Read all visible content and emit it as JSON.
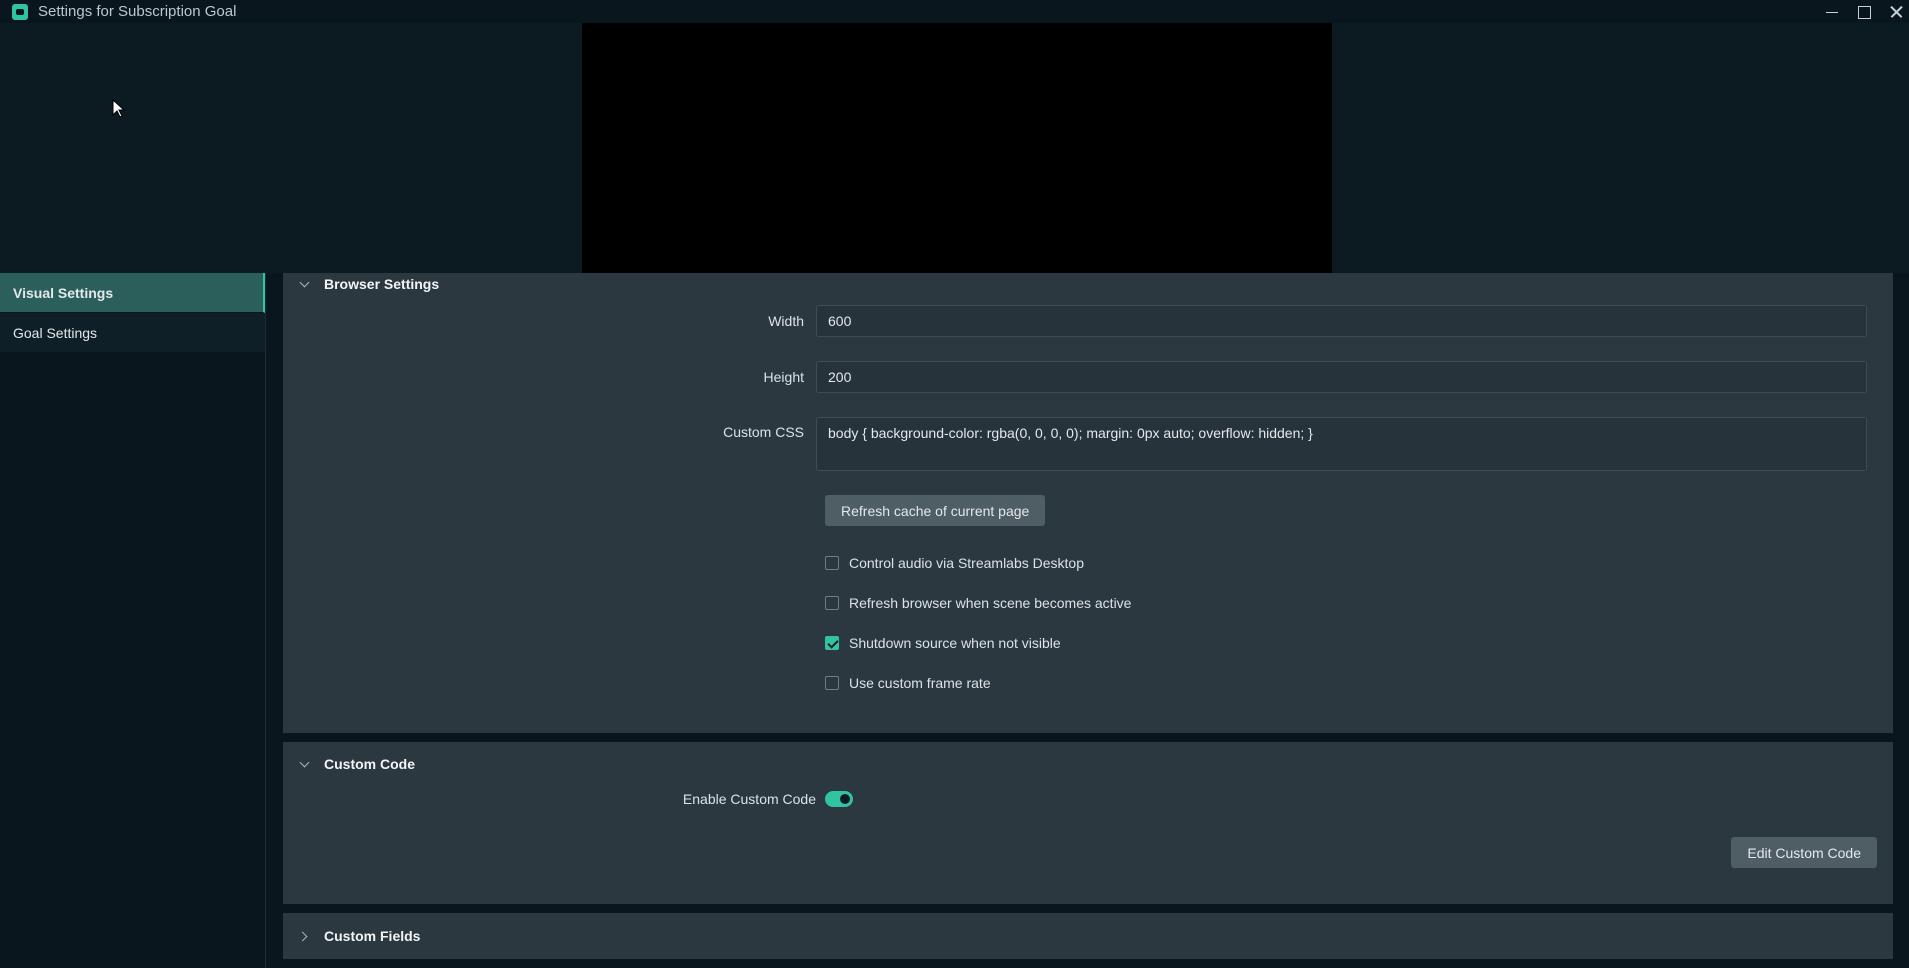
{
  "window": {
    "title": "Settings for Subscription Goal"
  },
  "sidebar": {
    "items": [
      {
        "label": "Visual Settings",
        "active": true
      },
      {
        "label": "Goal Settings",
        "active": false
      }
    ]
  },
  "browser_settings": {
    "title": "Browser Settings",
    "width_label": "Width",
    "width_value": "600",
    "height_label": "Height",
    "height_value": "200",
    "css_label": "Custom CSS",
    "css_value": "body { background-color: rgba(0, 0, 0, 0); margin: 0px auto; overflow: hidden; }",
    "refresh_cache_label": "Refresh cache of current page",
    "checkboxes": [
      {
        "label": "Control audio via Streamlabs Desktop",
        "checked": false
      },
      {
        "label": "Refresh browser when scene becomes active",
        "checked": false
      },
      {
        "label": "Shutdown source when not visible",
        "checked": true
      },
      {
        "label": "Use custom frame rate",
        "checked": false
      }
    ]
  },
  "custom_code": {
    "title": "Custom Code",
    "enable_label": "Enable Custom Code",
    "enabled": true,
    "edit_button_label": "Edit Custom Code"
  },
  "custom_fields": {
    "title": "Custom Fields"
  },
  "colors": {
    "accent": "#31c3a2",
    "active_item_bg": "#2b5f5c",
    "panel_bg": "#2b3840"
  }
}
